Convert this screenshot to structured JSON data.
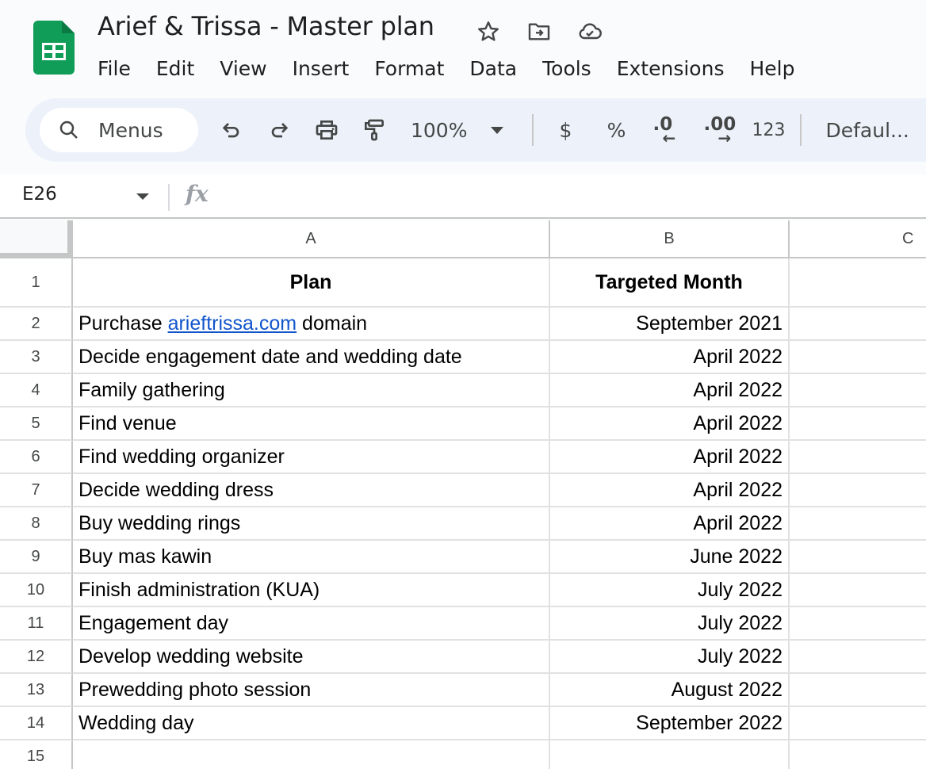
{
  "app": {
    "title": "Arief & Trissa - Master plan",
    "brand_color": "#0f9d58",
    "title_icons": [
      "star-icon",
      "move-to-folder-icon",
      "cloud-saved-icon"
    ]
  },
  "menubar": {
    "items": [
      "File",
      "Edit",
      "View",
      "Insert",
      "Format",
      "Data",
      "Tools",
      "Extensions",
      "Help"
    ]
  },
  "toolbar": {
    "search_label": "Menus",
    "zoom": "100%",
    "currency": "$",
    "percent": "%",
    "decrease_decimal": ".0",
    "increase_decimal": ".00",
    "number_format": "123",
    "font": "Defaul..."
  },
  "formula_bar": {
    "name_box": "E26",
    "fx_label": "fx",
    "formula": ""
  },
  "grid": {
    "columns": [
      "A",
      "B",
      "C"
    ],
    "rows": [
      {
        "num": "1",
        "a": "Plan",
        "b": "Targeted Month",
        "header": true
      },
      {
        "num": "2",
        "a_prefix": "Purchase ",
        "a_link": "arieftrissa.com",
        "a_suffix": " domain",
        "b": "September 2021"
      },
      {
        "num": "3",
        "a": "Decide engagement date and wedding date",
        "b": "April 2022"
      },
      {
        "num": "4",
        "a": "Family gathering",
        "b": "April 2022"
      },
      {
        "num": "5",
        "a": "Find venue",
        "b": "April 2022"
      },
      {
        "num": "6",
        "a": "Find wedding organizer",
        "b": "April 2022"
      },
      {
        "num": "7",
        "a": "Decide wedding dress",
        "b": "April 2022"
      },
      {
        "num": "8",
        "a": "Buy wedding rings",
        "b": "April 2022"
      },
      {
        "num": "9",
        "a": "Buy mas kawin",
        "b": "June 2022"
      },
      {
        "num": "10",
        "a": "Finish administration (KUA)",
        "b": "July 2022"
      },
      {
        "num": "11",
        "a": "Engagement day",
        "b": "July 2022"
      },
      {
        "num": "12",
        "a": "Develop wedding website",
        "b": "July 2022"
      },
      {
        "num": "13",
        "a": "Prewedding photo session",
        "b": "August 2022"
      },
      {
        "num": "14",
        "a": "Wedding day",
        "b": "September 2022"
      },
      {
        "num": "15",
        "a": "",
        "b": ""
      }
    ],
    "link_color": "#1155cc"
  }
}
